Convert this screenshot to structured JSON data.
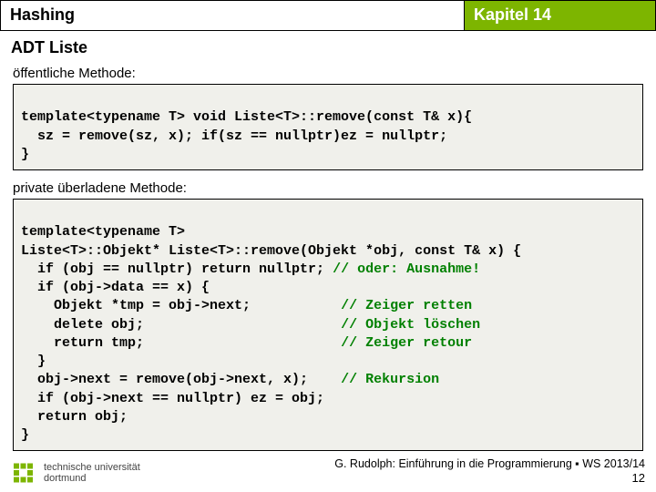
{
  "header": {
    "left": "Hashing",
    "right": "Kapitel 14"
  },
  "title": "ADT Liste",
  "public_label": "öffentliche Methode:",
  "private_label": "private überladene Methode:",
  "code1": {
    "l1": "template<typename T> void Liste<T>::remove(const T& x){",
    "l2": "  sz = remove(sz, x); if(sz == nullptr)ez = nullptr;",
    "l3": "}"
  },
  "code2": {
    "l1": "template<typename T>",
    "l2": "Liste<T>::Objekt* Liste<T>::remove(Objekt *obj, const T& x) {",
    "l3a": "  if (obj == nullptr) return nullptr; ",
    "l3b": "// oder: Ausnahme!",
    "l4": "  if (obj->data == x) {",
    "l5a": "    Objekt *tmp = obj->next;           ",
    "l5b": "// Zeiger retten",
    "l6a": "    delete obj;                        ",
    "l6b": "// Objekt löschen",
    "l7a": "    return tmp;                        ",
    "l7b": "// Zeiger retour",
    "l8": "  }",
    "l9a": "  obj->next = remove(obj->next, x);    ",
    "l9b": "// Rekursion",
    "l10": "  if (obj->next == nullptr) ez = obj;",
    "l11": "  return obj;",
    "l12": "}"
  },
  "footer": {
    "uni1": "technische universität",
    "uni2": "dortmund",
    "credits": "G. Rudolph: Einführung in die Programmierung ▪ WS 2013/14",
    "page": "12"
  }
}
